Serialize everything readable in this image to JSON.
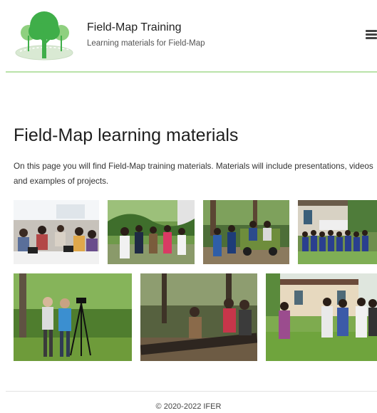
{
  "header": {
    "title": "Field-Map Training",
    "subtitle": "Learning materials for Field-Map"
  },
  "main": {
    "heading": "Field-Map learning materials",
    "intro": "On this page you will find Field-Map training materials. Materials will include presentations, videos and examples of projects."
  },
  "colors": {
    "header_rule": "#b9e3a9",
    "logo_tree": "#3fae49",
    "logo_bg": "#d9e9d3"
  },
  "icons": {
    "logo": "tree-logo-icon",
    "menu": "hamburger-menu-icon"
  },
  "footer": {
    "copyright": "© 2020-2022 IFER"
  }
}
